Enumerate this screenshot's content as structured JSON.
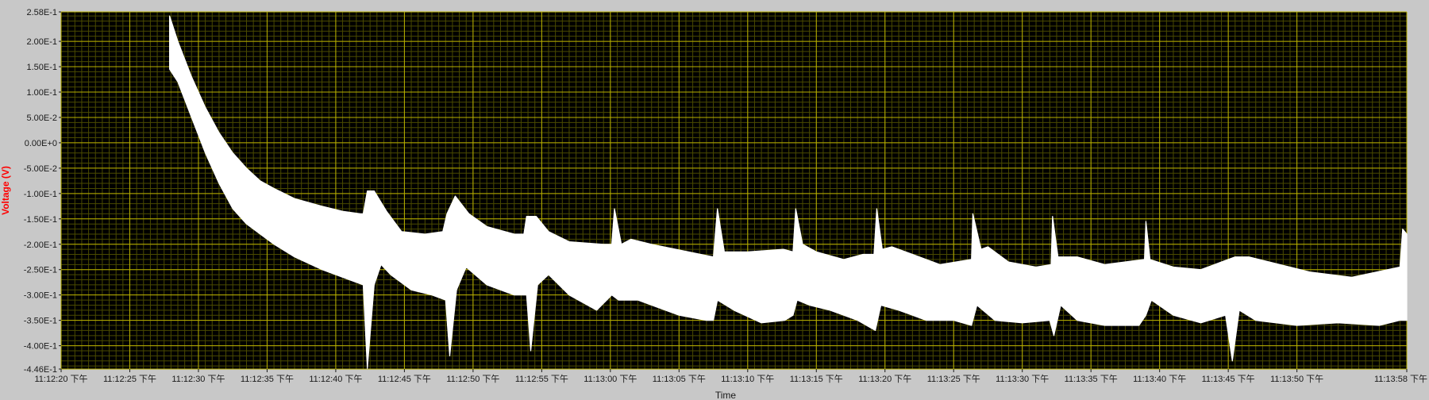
{
  "chart_data": {
    "type": "line",
    "xlabel": "Time",
    "ylabel": "Voltage (V)",
    "ylabel_color": "#ff0000",
    "plot_background": "#000000",
    "grid": true,
    "major_grid_color": "#b8b000",
    "minor_grid_color": "#4a4a00",
    "series_color": "#ffffff",
    "xlim": [
      0,
      98
    ],
    "ylim": [
      -0.446,
      0.258
    ],
    "xticks": [
      {
        "t": 0,
        "label": "11:12:20 下午"
      },
      {
        "t": 5,
        "label": "11:12:25 下午"
      },
      {
        "t": 10,
        "label": "11:12:30 下午"
      },
      {
        "t": 15,
        "label": "11:12:35 下午"
      },
      {
        "t": 20,
        "label": "11:12:40 下午"
      },
      {
        "t": 25,
        "label": "11:12:45 下午"
      },
      {
        "t": 30,
        "label": "11:12:50 下午"
      },
      {
        "t": 35,
        "label": "11:12:55 下午"
      },
      {
        "t": 40,
        "label": "11:13:00 下午"
      },
      {
        "t": 45,
        "label": "11:13:05 下午"
      },
      {
        "t": 50,
        "label": "11:13:10 下午"
      },
      {
        "t": 55,
        "label": "11:13:15 下午"
      },
      {
        "t": 60,
        "label": "11:13:20 下午"
      },
      {
        "t": 65,
        "label": "11:13:25 下午"
      },
      {
        "t": 70,
        "label": "11:13:30 下午"
      },
      {
        "t": 75,
        "label": "11:13:35 下午"
      },
      {
        "t": 80,
        "label": "11:13:40 下午"
      },
      {
        "t": 85,
        "label": "11:13:45 下午"
      },
      {
        "t": 90,
        "label": "11:13:50 下午"
      },
      {
        "t": 98,
        "label": "11:13:58 下午"
      }
    ],
    "yticks": [
      {
        "v": 0.258,
        "label": "2.58E-1"
      },
      {
        "v": 0.2,
        "label": "2.00E-1"
      },
      {
        "v": 0.15,
        "label": "1.50E-1"
      },
      {
        "v": 0.1,
        "label": "1.00E-1"
      },
      {
        "v": 0.05,
        "label": "5.00E-2"
      },
      {
        "v": 0.0,
        "label": "0.00E+0"
      },
      {
        "v": -0.05,
        "label": "-5.00E-2"
      },
      {
        "v": -0.1,
        "label": "-1.00E-1"
      },
      {
        "v": -0.15,
        "label": "-1.50E-1"
      },
      {
        "v": -0.2,
        "label": "-2.00E-1"
      },
      {
        "v": -0.25,
        "label": "-2.50E-1"
      },
      {
        "v": -0.3,
        "label": "-3.00E-1"
      },
      {
        "v": -0.35,
        "label": "-3.50E-1"
      },
      {
        "v": -0.4,
        "label": "-4.00E-1"
      },
      {
        "v": -0.446,
        "label": "-4.46E-1"
      }
    ],
    "series": [
      {
        "values_upper": [
          [
            7.9,
            0.25
          ],
          [
            8.5,
            0.2
          ],
          [
            9.5,
            0.13
          ],
          [
            10.5,
            0.07
          ],
          [
            11.5,
            0.02
          ],
          [
            12.5,
            -0.02
          ],
          [
            13.5,
            -0.05
          ],
          [
            14.5,
            -0.075
          ],
          [
            15.5,
            -0.09
          ],
          [
            17,
            -0.11
          ],
          [
            19,
            -0.125
          ],
          [
            20.5,
            -0.135
          ],
          [
            21.8,
            -0.14
          ],
          [
            22.0,
            -0.14
          ],
          [
            22.3,
            -0.095
          ],
          [
            22.8,
            -0.095
          ],
          [
            23.7,
            -0.135
          ],
          [
            24.8,
            -0.175
          ],
          [
            26.5,
            -0.18
          ],
          [
            27.8,
            -0.175
          ],
          [
            28.1,
            -0.14
          ],
          [
            28.7,
            -0.105
          ],
          [
            29.7,
            -0.14
          ],
          [
            31,
            -0.165
          ],
          [
            33,
            -0.18
          ],
          [
            33.7,
            -0.18
          ],
          [
            33.9,
            -0.145
          ],
          [
            34.6,
            -0.145
          ],
          [
            35.5,
            -0.175
          ],
          [
            37,
            -0.195
          ],
          [
            39.5,
            -0.2
          ],
          [
            40.1,
            -0.2
          ],
          [
            40.3,
            -0.13
          ],
          [
            40.8,
            -0.2
          ],
          [
            41.5,
            -0.19
          ],
          [
            43,
            -0.2
          ],
          [
            47.5,
            -0.225
          ],
          [
            47.8,
            -0.13
          ],
          [
            48.3,
            -0.215
          ],
          [
            50,
            -0.215
          ],
          [
            52.6,
            -0.21
          ],
          [
            53.3,
            -0.215
          ],
          [
            53.5,
            -0.13
          ],
          [
            54.0,
            -0.2
          ],
          [
            55,
            -0.215
          ],
          [
            57,
            -0.23
          ],
          [
            58.4,
            -0.22
          ],
          [
            59.2,
            -0.22
          ],
          [
            59.4,
            -0.13
          ],
          [
            59.8,
            -0.21
          ],
          [
            60.5,
            -0.205
          ],
          [
            62,
            -0.22
          ],
          [
            64,
            -0.24
          ],
          [
            66.3,
            -0.23
          ],
          [
            66.4,
            -0.14
          ],
          [
            67,
            -0.21
          ],
          [
            67.5,
            -0.205
          ],
          [
            69,
            -0.235
          ],
          [
            71,
            -0.245
          ],
          [
            72.1,
            -0.24
          ],
          [
            72.2,
            -0.145
          ],
          [
            72.6,
            -0.225
          ],
          [
            74,
            -0.225
          ],
          [
            76,
            -0.24
          ],
          [
            78.9,
            -0.23
          ],
          [
            79.0,
            -0.155
          ],
          [
            79.3,
            -0.23
          ],
          [
            81,
            -0.245
          ],
          [
            83,
            -0.25
          ],
          [
            84.5,
            -0.235
          ],
          [
            85.5,
            -0.225
          ],
          [
            86.5,
            -0.225
          ],
          [
            88,
            -0.235
          ],
          [
            91,
            -0.255
          ],
          [
            94,
            -0.265
          ],
          [
            97.5,
            -0.245
          ],
          [
            97.7,
            -0.17
          ],
          [
            98,
            -0.18
          ]
        ],
        "values_lower": [
          [
            7.9,
            0.145
          ],
          [
            8.5,
            0.12
          ],
          [
            9.5,
            0.05
          ],
          [
            10.5,
            -0.02
          ],
          [
            11.5,
            -0.08
          ],
          [
            12.5,
            -0.13
          ],
          [
            13.5,
            -0.16
          ],
          [
            14.5,
            -0.18
          ],
          [
            15.5,
            -0.2
          ],
          [
            17,
            -0.225
          ],
          [
            19,
            -0.25
          ],
          [
            21,
            -0.27
          ],
          [
            22.0,
            -0.28
          ],
          [
            22.3,
            -0.445
          ],
          [
            22.8,
            -0.28
          ],
          [
            23.3,
            -0.24
          ],
          [
            24,
            -0.26
          ],
          [
            25.5,
            -0.29
          ],
          [
            27,
            -0.3
          ],
          [
            28.0,
            -0.31
          ],
          [
            28.3,
            -0.42
          ],
          [
            28.8,
            -0.29
          ],
          [
            29.5,
            -0.245
          ],
          [
            31,
            -0.28
          ],
          [
            33,
            -0.3
          ],
          [
            33.9,
            -0.3
          ],
          [
            34.2,
            -0.41
          ],
          [
            34.7,
            -0.28
          ],
          [
            35.5,
            -0.26
          ],
          [
            37,
            -0.3
          ],
          [
            39,
            -0.33
          ],
          [
            40.1,
            -0.3
          ],
          [
            40.6,
            -0.31
          ],
          [
            42,
            -0.31
          ],
          [
            45,
            -0.34
          ],
          [
            47,
            -0.35
          ],
          [
            47.5,
            -0.35
          ],
          [
            47.8,
            -0.31
          ],
          [
            49,
            -0.33
          ],
          [
            51,
            -0.355
          ],
          [
            52.7,
            -0.35
          ],
          [
            53.3,
            -0.34
          ],
          [
            53.6,
            -0.31
          ],
          [
            54.5,
            -0.32
          ],
          [
            56,
            -0.33
          ],
          [
            58,
            -0.35
          ],
          [
            59.3,
            -0.37
          ],
          [
            59.7,
            -0.32
          ],
          [
            61,
            -0.33
          ],
          [
            63,
            -0.35
          ],
          [
            65,
            -0.35
          ],
          [
            66.3,
            -0.36
          ],
          [
            66.7,
            -0.32
          ],
          [
            68,
            -0.35
          ],
          [
            70,
            -0.355
          ],
          [
            72.0,
            -0.35
          ],
          [
            72.3,
            -0.38
          ],
          [
            72.8,
            -0.32
          ],
          [
            74,
            -0.35
          ],
          [
            76,
            -0.36
          ],
          [
            78.5,
            -0.36
          ],
          [
            79.0,
            -0.34
          ],
          [
            79.4,
            -0.31
          ],
          [
            81,
            -0.34
          ],
          [
            83,
            -0.355
          ],
          [
            84.8,
            -0.34
          ],
          [
            85.3,
            -0.43
          ],
          [
            85.8,
            -0.33
          ],
          [
            87,
            -0.35
          ],
          [
            90,
            -0.36
          ],
          [
            93,
            -0.355
          ],
          [
            96,
            -0.36
          ],
          [
            97.5,
            -0.35
          ],
          [
            98,
            -0.35
          ]
        ]
      }
    ]
  }
}
